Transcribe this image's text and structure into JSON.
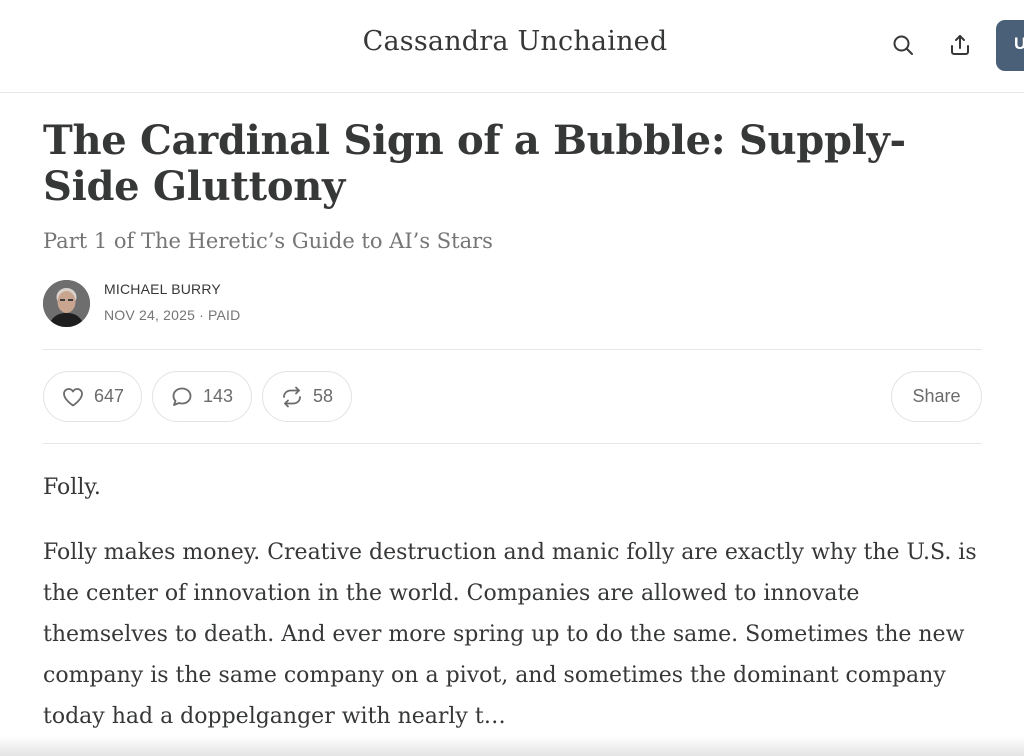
{
  "header": {
    "publication_title": "Cassandra Unchained",
    "search_icon": "search-icon",
    "share_icon": "share-upload-icon",
    "user_button_label": "U"
  },
  "post": {
    "title": "The Cardinal Sign of a Bubble: Supply-Side Gluttony",
    "subtitle": "Part 1 of The Heretic’s Guide to AI’s Stars",
    "author": "MICHAEL BURRY",
    "date": "NOV 24, 2025",
    "separator": "·",
    "access": "PAID"
  },
  "actions": {
    "likes": "647",
    "comments": "143",
    "restacks": "58",
    "share_label": "Share",
    "like_icon": "heart-icon",
    "comment_icon": "comment-bubble-icon",
    "restack_icon": "restack-icon"
  },
  "body": {
    "paragraphs": [
      "Folly.",
      "Folly makes money. Creative destruction and manic folly are exactly why the U.S. is the center of innovation in the world. Companies are allowed to innovate themselves to death. And ever more spring up to do the same. Sometimes the new company is the same company on a pivot, and sometimes the dominant company today had a doppelganger with nearly t…"
    ]
  },
  "colors": {
    "text": "#363737",
    "muted": "#757575",
    "user_button": "#4a5f78",
    "divider": "#e6e6e6"
  }
}
